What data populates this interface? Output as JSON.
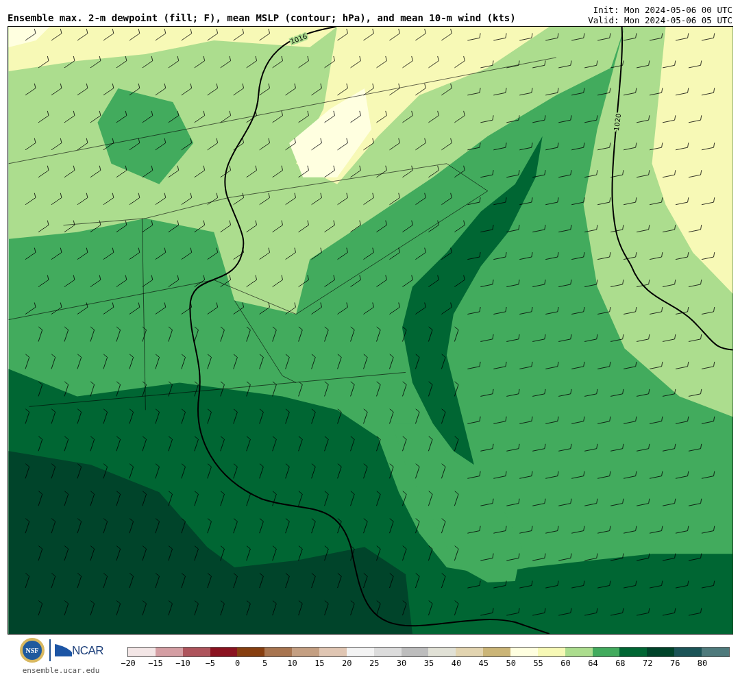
{
  "title": "Ensemble max. 2-m dewpoint (fill; F), mean MSLP (contour; hPa), and mean 10-m wind (kts)",
  "init": "Init: Mon 2024-05-06 00 UTC",
  "valid": "Valid: Mon 2024-05-06 05 UTC",
  "map": {
    "isobars": [
      {
        "label": "1016"
      },
      {
        "label": "1020"
      }
    ]
  },
  "colorbar": {
    "bins": [
      {
        "color": "#f3e6e6"
      },
      {
        "color": "#d49ea3"
      },
      {
        "color": "#ae545c"
      },
      {
        "color": "#8b1320"
      },
      {
        "color": "#873f10"
      },
      {
        "color": "#a87550"
      },
      {
        "color": "#c49f82"
      },
      {
        "color": "#e0c6b3"
      },
      {
        "color": "#f3f3f3"
      },
      {
        "color": "#dcdcdc"
      },
      {
        "color": "#bdbdbd"
      },
      {
        "color": "#e1e1d6"
      },
      {
        "color": "#e2d4b0"
      },
      {
        "color": "#cbb577"
      },
      {
        "color": "#ffffe0"
      },
      {
        "color": "#f7f9b6"
      },
      {
        "color": "#acdd8e"
      },
      {
        "color": "#42ab5d"
      },
      {
        "color": "#006633"
      },
      {
        "color": "#00442a"
      },
      {
        "color": "#1b5457"
      },
      {
        "color": "#4e7a7c"
      }
    ],
    "ticks": [
      "−20",
      "−15",
      "−10",
      "−5",
      "0",
      "5",
      "10",
      "15",
      "20",
      "25",
      "30",
      "35",
      "40",
      "45",
      "50",
      "55",
      "60",
      "64",
      "68",
      "72",
      "76",
      "80"
    ]
  },
  "logos": {
    "nsf": "NSF",
    "ncar": "NCAR"
  },
  "footer": "ensemble.ucar.edu"
}
